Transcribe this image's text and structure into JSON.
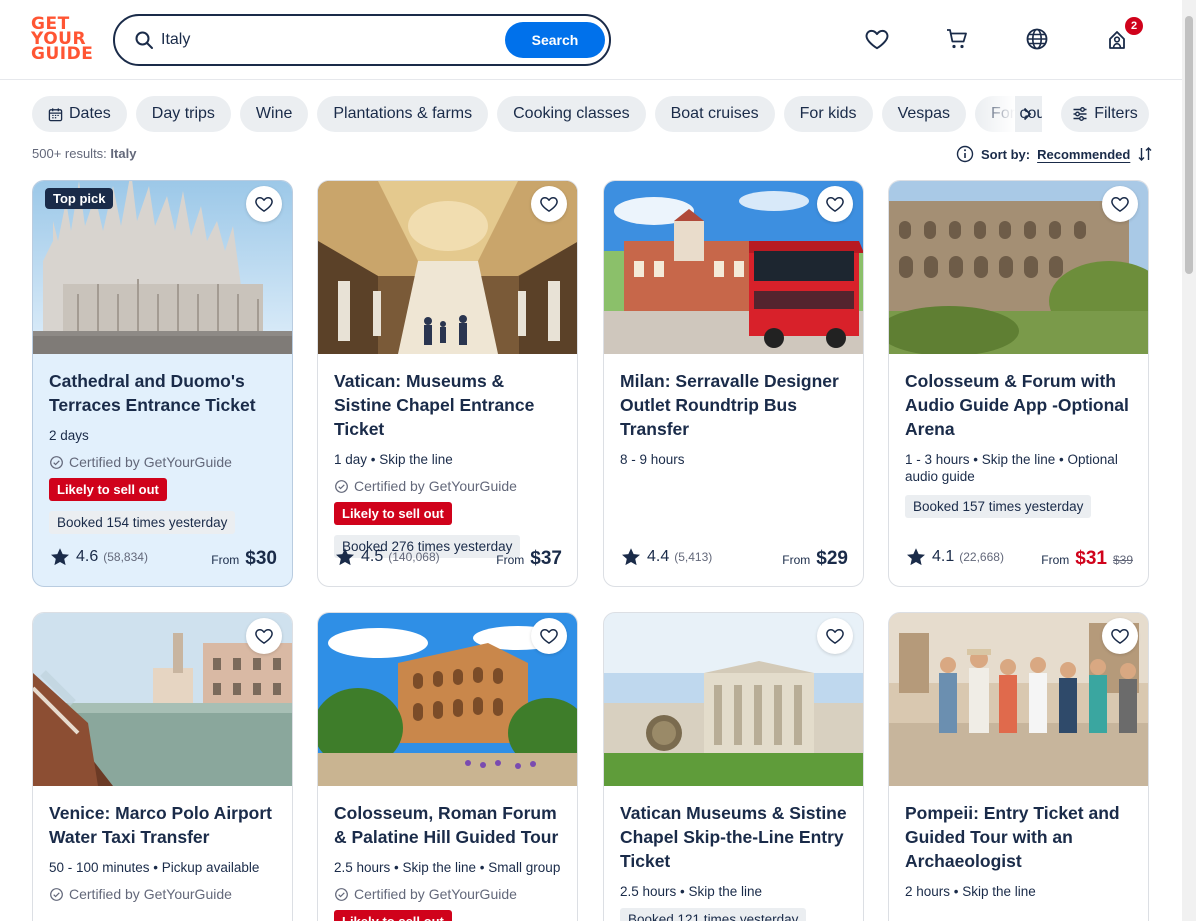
{
  "logo": {
    "line1": "GET",
    "line2": "YOUR",
    "line3": "GUIDE"
  },
  "search": {
    "value": "Italy",
    "button": "Search"
  },
  "header": {
    "cart_badge": "2"
  },
  "chips": [
    "Dates",
    "Day trips",
    "Wine",
    "Plantations & farms",
    "Cooking classes",
    "Boat cruises",
    "For kids",
    "Vespas",
    "For couples"
  ],
  "filters_label": "Filters",
  "results": {
    "count": "500+ results:",
    "query": "Italy"
  },
  "sort": {
    "label": "Sort by:",
    "value": "Recommended"
  },
  "labels": {
    "certified": "Certified by GetYourGuide",
    "likely": "Likely to sell out",
    "from": "From",
    "top_pick": "Top pick"
  },
  "cards": [
    {
      "title": "Cathedral and Duomo's Terraces Entrance Ticket",
      "meta": "2 days",
      "booked": "Booked 154 times yesterday",
      "rating": "4.6",
      "count": "(58,834)",
      "price": "$30"
    },
    {
      "title": "Vatican: Museums & Sistine Chapel Entrance Ticket",
      "meta": "1 day • Skip the line",
      "booked": "Booked 276 times yesterday",
      "rating": "4.5",
      "count": "(140,068)",
      "price": "$37"
    },
    {
      "title": "Milan: Serravalle Designer Outlet Roundtrip Bus Transfer",
      "meta": "8 - 9 hours",
      "rating": "4.4",
      "count": "(5,413)",
      "price": "$29"
    },
    {
      "title": "Colosseum & Forum with Audio Guide App -Optional Arena",
      "meta": "1 - 3 hours • Skip the line • Optional audio guide",
      "booked": "Booked 157 times yesterday",
      "rating": "4.1",
      "count": "(22,668)",
      "price": "$31",
      "old_price": "$39"
    },
    {
      "title": "Venice: Marco Polo Airport Water Taxi Transfer",
      "meta": "50 - 100 minutes • Pickup available"
    },
    {
      "title": "Colosseum, Roman Forum & Palatine Hill Guided Tour",
      "meta": "2.5 hours • Skip the line • Small group"
    },
    {
      "title": "Vatican Museums & Sistine Chapel Skip-the-Line Entry Ticket",
      "meta": "2.5 hours • Skip the line",
      "booked": "Booked 121 times yesterday"
    },
    {
      "title": "Pompeii: Entry Ticket and Guided Tour with an Archaeologist",
      "meta": "2 hours • Skip the line"
    }
  ],
  "colors": {
    "brand": "#ff5533",
    "primary": "#0071eb",
    "text": "#1a2b49",
    "danger": "#d0021b",
    "highlight": "#e2f0fc"
  }
}
